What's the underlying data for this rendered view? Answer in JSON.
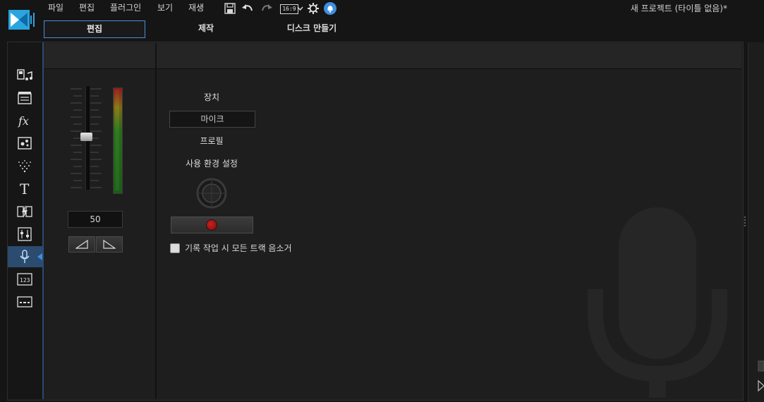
{
  "menu": [
    "파일",
    "편집",
    "플러그인",
    "보기",
    "재생"
  ],
  "toolbar": {
    "aspect_ratio": "16:9",
    "icons": [
      "save-icon",
      "undo-icon",
      "redo-icon",
      "aspect-ratio-icon",
      "settings-gear-icon",
      "notification-bell-icon"
    ]
  },
  "window_title": "새 프로젝트 (타이틀 없음)*",
  "mode_tabs": [
    "편집",
    "제작",
    "디스크 만들기"
  ],
  "active_mode_tab": "편집",
  "left_rail": {
    "icons": [
      "media-room-icon",
      "title-room-icon",
      "effects-fx-icon",
      "pip-objects-icon",
      "particle-room-icon",
      "text-title-icon",
      "transition-icon",
      "audio-mixing-icon",
      "voice-over-mic-icon",
      "chapter-icon",
      "subtitle-icon"
    ],
    "active": "voice-over-mic-icon"
  },
  "volume": {
    "value": "50",
    "level": 0.5
  },
  "record": {
    "device_label": "장치",
    "device_value": "마이크",
    "profile_label": "프로필",
    "preferences_label": "사용 환경 설정",
    "mute_all_label": "기록 작업 시 모든 트랙 음소거",
    "mute_all_checked": false
  },
  "colors": {
    "accent": "#3d8fe0",
    "record": "#c01818",
    "background": "#1e1e1e"
  }
}
